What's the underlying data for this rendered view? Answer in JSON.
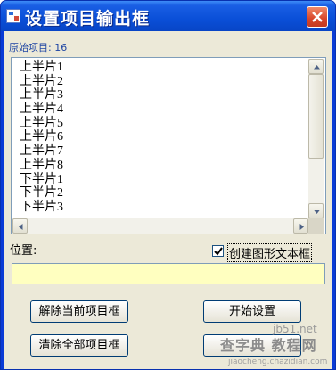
{
  "window": {
    "title": "设置项目输出框"
  },
  "count": {
    "label": "原始项目: 16"
  },
  "list": {
    "items": [
      "上半片1",
      "上半片2",
      "上半片3",
      "上半片4",
      "上半片5",
      "上半片6",
      "上半片7",
      "上半片8",
      "下半片1",
      "下半片2",
      "下半片3"
    ]
  },
  "position": {
    "label": "位置:",
    "value": ""
  },
  "checkbox": {
    "label": "创建图形文本框",
    "checked": true
  },
  "buttons": {
    "remove_current": "解除当前项目框",
    "start_setup": "开始设置",
    "clear_all": "清除全部项目框"
  },
  "watermark": {
    "site": "jb51.net",
    "brand": "查字典 教程网",
    "url": "jiaocheng.chazidian.com"
  },
  "colors": {
    "titlebar": "#0a4fd8",
    "client_bg": "#ece9d8",
    "input_bg": "#ffffc0",
    "count_label": "#1e45a3",
    "close_button": "#d8452a"
  }
}
